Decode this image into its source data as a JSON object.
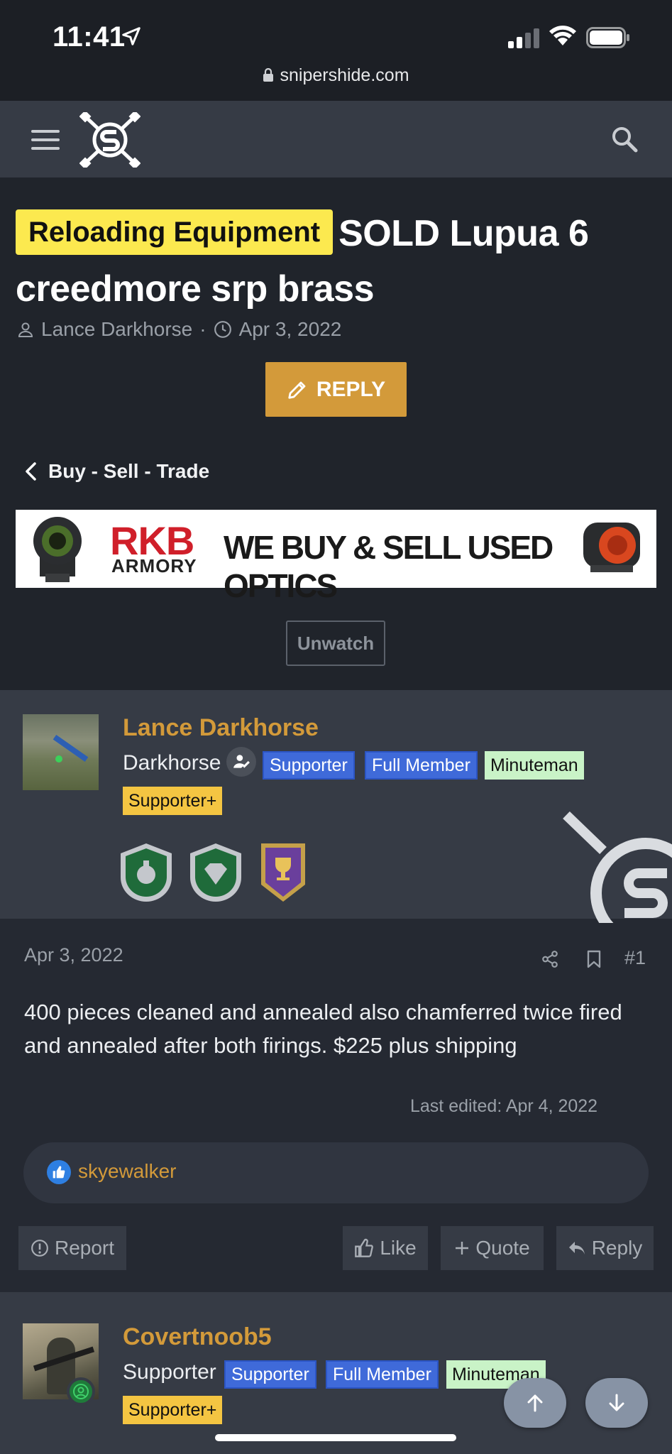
{
  "status_bar": {
    "time": "11:41"
  },
  "browser": {
    "url": "snipershide.com"
  },
  "thread": {
    "prefix": "Reloading Equipment",
    "title": "SOLD Lupua 6 creedmore srp brass",
    "author": "Lance Darkhorse",
    "date": "Apr 3, 2022",
    "reply_label": "REPLY",
    "breadcrumb": "Buy - Sell - Trade",
    "unwatch_label": "Unwatch"
  },
  "banner": {
    "brand": "RKB",
    "brand_sub": "ARMORY",
    "tagline": "WE BUY & SELL USED OPTICS"
  },
  "post1": {
    "author": "Lance Darkhorse",
    "user_title": "Darkhorse",
    "badges": [
      "Supporter",
      "Full Member",
      "Minuteman",
      "Supporter+"
    ],
    "date": "Apr 3, 2022",
    "number": "#1",
    "body": "400 pieces cleaned and annealed also chamferred twice fired and annealed after both firings. $225 plus shipping",
    "last_edited": "Last edited: Apr 4, 2022",
    "reaction_user": "skyewalker",
    "actions": {
      "report": "Report",
      "like": "Like",
      "quote": "Quote",
      "reply": "Reply"
    }
  },
  "post2": {
    "author": "Covertnoob5",
    "user_title": "Supporter",
    "badges": [
      "Supporter",
      "Full Member",
      "Minuteman",
      "Supporter+"
    ]
  },
  "colors": {
    "accent": "#d39a3a",
    "prefix_bg": "#fce94f",
    "badge_blue": "#3f6ad9",
    "badge_green": "#c9f3c7",
    "badge_yellow": "#f4c542"
  }
}
